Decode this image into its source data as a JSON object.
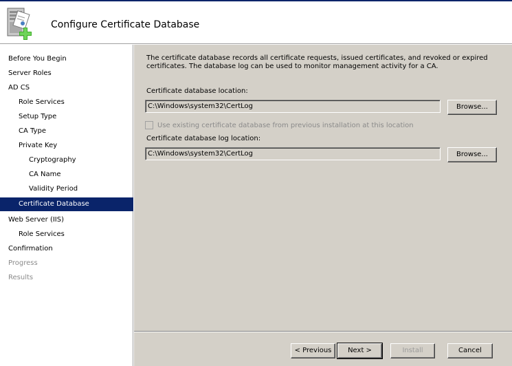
{
  "header": {
    "title": "Configure Certificate Database",
    "icon": "server-certificate-icon"
  },
  "sidebar": {
    "items": [
      {
        "label": "Before You Begin",
        "level": 0,
        "state": "normal"
      },
      {
        "label": "Server Roles",
        "level": 0,
        "state": "normal"
      },
      {
        "label": "AD CS",
        "level": 0,
        "state": "normal"
      },
      {
        "label": "Role Services",
        "level": 1,
        "state": "normal"
      },
      {
        "label": "Setup Type",
        "level": 1,
        "state": "normal"
      },
      {
        "label": "CA Type",
        "level": 1,
        "state": "normal"
      },
      {
        "label": "Private Key",
        "level": 1,
        "state": "normal"
      },
      {
        "label": "Cryptography",
        "level": 2,
        "state": "normal"
      },
      {
        "label": "CA Name",
        "level": 2,
        "state": "normal"
      },
      {
        "label": "Validity Period",
        "level": 2,
        "state": "normal"
      },
      {
        "label": "Certificate Database",
        "level": 1,
        "state": "selected"
      },
      {
        "label": "Web Server (IIS)",
        "level": 0,
        "state": "normal"
      },
      {
        "label": "Role Services",
        "level": 1,
        "state": "normal"
      },
      {
        "label": "Confirmation",
        "level": 0,
        "state": "normal"
      },
      {
        "label": "Progress",
        "level": 0,
        "state": "disabled"
      },
      {
        "label": "Results",
        "level": 0,
        "state": "disabled"
      }
    ]
  },
  "main": {
    "description": "The certificate database records all certificate requests, issued certificates, and revoked or expired certificates. The database log can be used to monitor management activity for a CA.",
    "db_location": {
      "label": "Certificate database location:",
      "value": "C:\\Windows\\system32\\CertLog",
      "browse_label": "Browse..."
    },
    "use_existing": {
      "label": "Use existing certificate database from previous installation at this location",
      "checked": false,
      "enabled": false
    },
    "log_location": {
      "label": "Certificate database log location:",
      "value": "C:\\Windows\\system32\\CertLog",
      "browse_label": "Browse..."
    }
  },
  "footer": {
    "previous_label": "< Previous",
    "next_label": "Next >",
    "install_label": "Install",
    "cancel_label": "Cancel"
  },
  "colors": {
    "selection": "#0a246a",
    "panel": "#d4d0c8",
    "disabled_text": "#8a8a8a"
  }
}
